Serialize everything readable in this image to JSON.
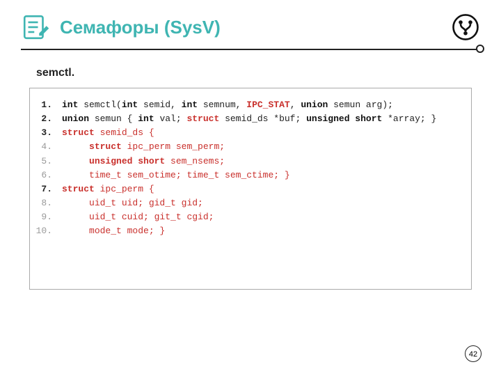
{
  "title": "Семафоры (SysV)",
  "subhead": "semctl.",
  "page_number": "42",
  "lines": {
    "l1": {
      "n": "1.",
      "strong": true
    },
    "l2": {
      "n": "2.",
      "strong": true
    },
    "l3": {
      "n": "3.",
      "strong": true
    },
    "l4": {
      "n": "4.",
      "strong": false
    },
    "l5": {
      "n": "5.",
      "strong": false
    },
    "l6": {
      "n": "6.",
      "strong": false
    },
    "l7": {
      "n": "7.",
      "strong": true
    },
    "l8": {
      "n": "8.",
      "strong": false
    },
    "l9": {
      "n": "9.",
      "strong": false
    },
    "l10": {
      "n": "10.",
      "strong": false
    }
  },
  "tok": {
    "int": "int",
    "semctl_open": " semctl(",
    "semctl_arg1": " semid, ",
    "semctl_arg2": " semnum, ",
    "ipc_stat": "IPC_STAT",
    "comma_sp": ", ",
    "union": "union",
    "semun_arg_close": " semun arg);",
    "semun_open": " semun { ",
    "val_semi": " val; ",
    "struct": "struct",
    "semid_ds_buf": " semid_ds *buf; ",
    "unsigned_short": "unsigned short",
    "array_close": " *array; }",
    "semid_ds_open": " semid_ds {",
    "indent": "     ",
    "ipc_perm_sem_perm": " ipc_perm sem_perm;",
    "sem_nsems": " sem_nsems;",
    "time_line": "time_t sem_otime; time_t sem_ctime; }",
    "ipc_perm_open": " ipc_perm {",
    "uid_gid": "uid_t uid; gid_t gid;",
    "cuid_cgid": "uid_t cuid; git_t cgid;",
    "mode_close": "mode_t mode; }"
  }
}
